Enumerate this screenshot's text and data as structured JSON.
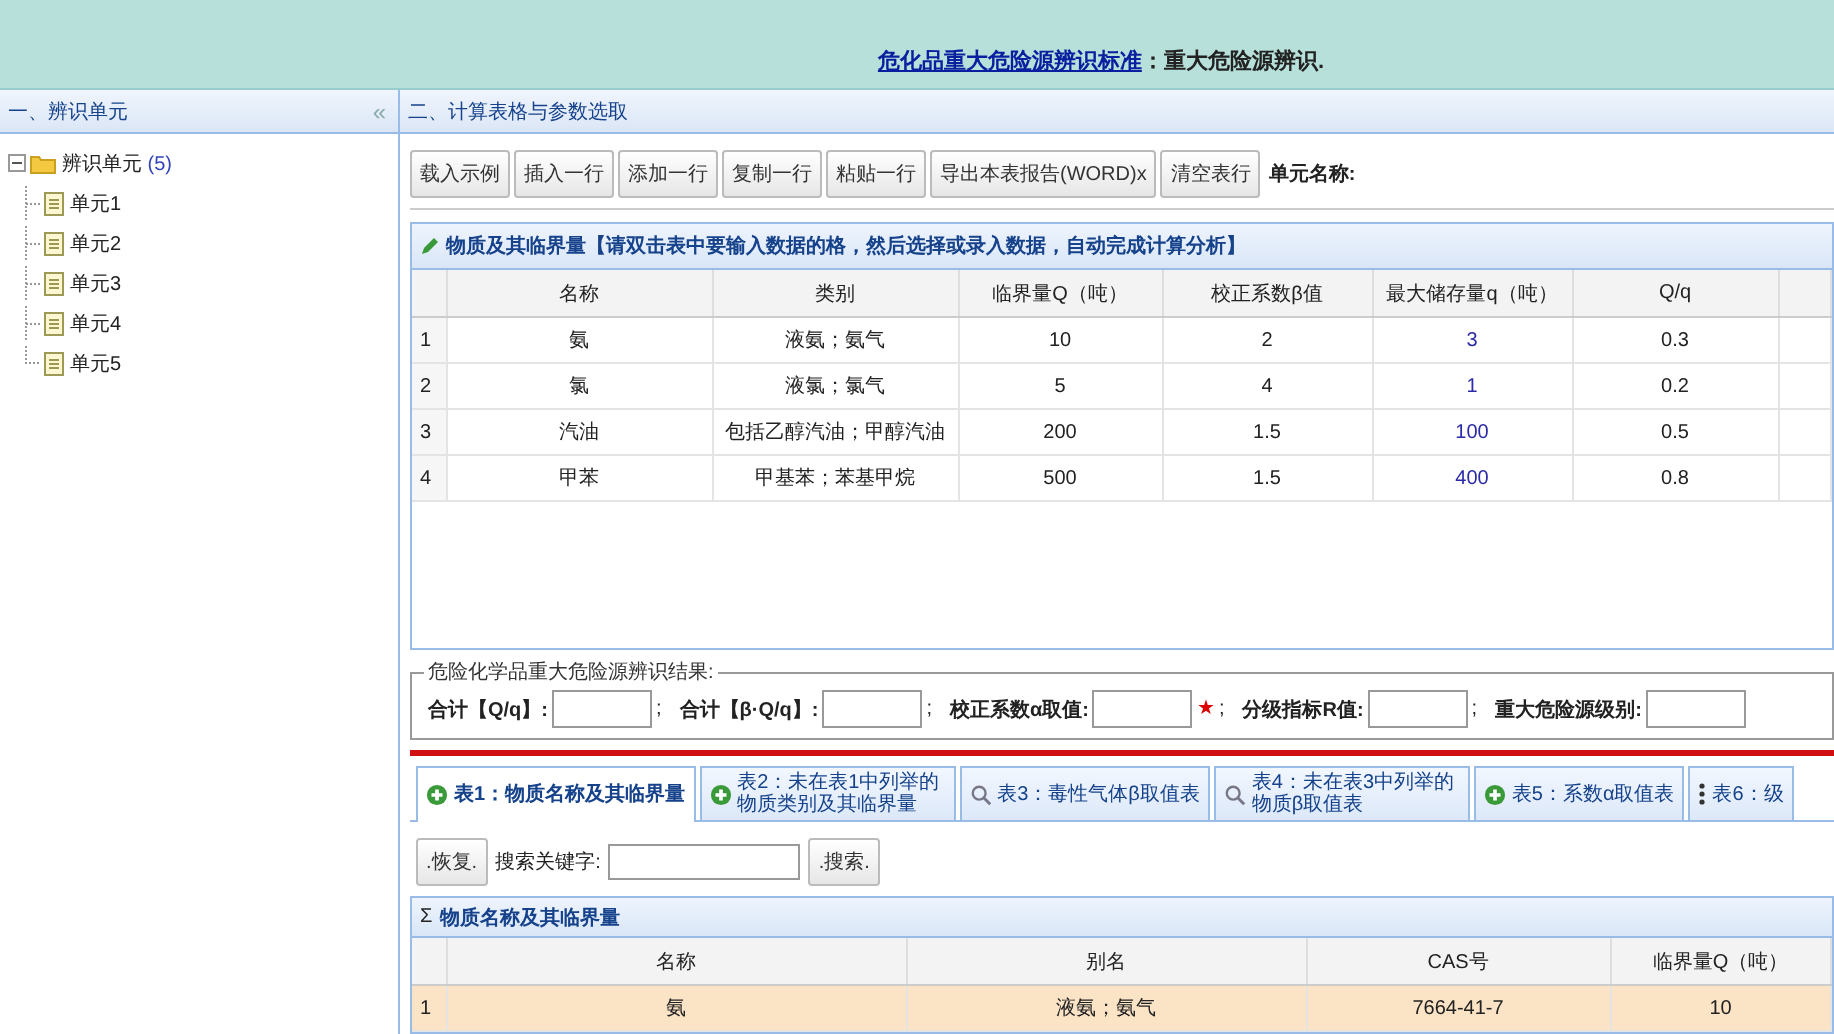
{
  "header": {
    "link": "危化品重大危险源辨识标准",
    "text": "：重大危险源辨识."
  },
  "left_panel": {
    "title": "一、辨识单元",
    "collapse": "«",
    "tree": {
      "label": "辨识单元",
      "count": "(5)",
      "expanded": true,
      "children": [
        {
          "label": "单元1"
        },
        {
          "label": "单元2"
        },
        {
          "label": "单元3"
        },
        {
          "label": "单元4"
        },
        {
          "label": "单元5"
        }
      ]
    }
  },
  "right_panel": {
    "title": "二、计算表格与参数选取",
    "toolbar": {
      "buttons": [
        "载入示例",
        "插入一行",
        "添加一行",
        "复制一行",
        "粘贴一行",
        "导出本表报告(WORD)x",
        "清空表行"
      ],
      "label": "单元名称:"
    },
    "grid": {
      "title": "物质及其临界量【请双击表中要输入数据的格，然后选择或录入数据，自动完成计算分析】",
      "columns": [
        "",
        "名称",
        "类别",
        "临界量Q（吨）",
        "校正系数β值",
        "最大储存量q（吨）",
        "Q/q"
      ],
      "rows": [
        [
          "1",
          "氨",
          "液氨；氨气",
          "10",
          "2",
          "3",
          "0.3"
        ],
        [
          "2",
          "氯",
          "液氯；氯气",
          "5",
          "4",
          "1",
          "0.2"
        ],
        [
          "3",
          "汽油",
          "包括乙醇汽油；甲醇汽油",
          "200",
          "1.5",
          "100",
          "0.5"
        ],
        [
          "4",
          "甲苯",
          "甲基苯；苯基甲烷",
          "500",
          "1.5",
          "400",
          "0.8"
        ]
      ]
    },
    "result": {
      "legend": "危险化学品重大危险源辨识结果:",
      "fields": [
        {
          "label": "合计【Q/q】:",
          "separator": ";"
        },
        {
          "label": "合计【β·Q/q】:",
          "separator": ";"
        },
        {
          "label": "校正系数α取值:",
          "marker": "★",
          "separator": ";"
        },
        {
          "label": "分级指标R值:",
          "separator": ";"
        },
        {
          "label": "重大危险源级别:"
        }
      ]
    },
    "tabs": [
      {
        "label": "表1：物质名称及其临界量",
        "kind": "plus",
        "selected": true
      },
      {
        "label": "表2：未在表1中列举的物质类别及其临界量",
        "kind": "plus",
        "selected": false
      },
      {
        "label": "表3：毒性气体β取值表",
        "kind": "search",
        "selected": false
      },
      {
        "label": "表4：未在表3中列举的物质β取值表",
        "kind": "search",
        "selected": false
      },
      {
        "label": "表5：系数α取值表",
        "kind": "plus",
        "selected": false
      },
      {
        "label": "表6：级",
        "kind": "more",
        "selected": false
      }
    ],
    "search": {
      "reset": ".恢复.",
      "label": "搜索关键字:",
      "button": ".搜索."
    },
    "sub_table": {
      "sigma": "Σ",
      "title": "物质名称及其临界量",
      "columns": [
        "",
        "名称",
        "别名",
        "CAS号",
        "临界量Q（吨）"
      ],
      "rows": [
        {
          "cells": [
            "1",
            "氨",
            "液氨；氨气",
            "7664-41-7",
            "10"
          ],
          "selected": true
        }
      ]
    }
  }
}
